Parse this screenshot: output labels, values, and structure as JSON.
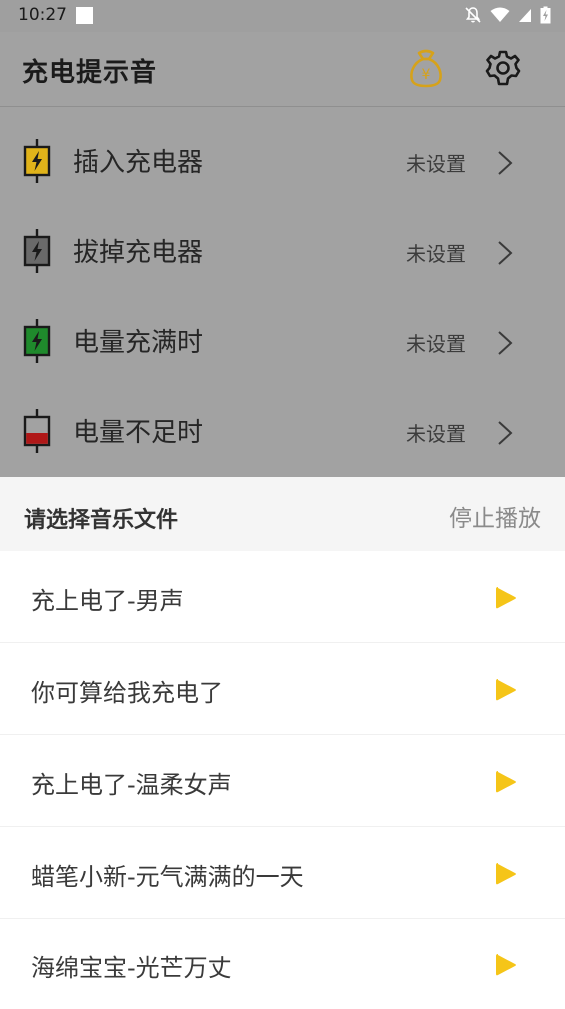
{
  "status_bar": {
    "time": "10:27"
  },
  "app_bar": {
    "title": "充电提示音"
  },
  "settings": [
    {
      "label": "插入充电器",
      "value": "未设置",
      "icon": "battery-plug-in-icon",
      "color": "#e0b31a"
    },
    {
      "label": "拔掉充电器",
      "value": "未设置",
      "icon": "battery-unplug-icon",
      "color": "#6a6a6a"
    },
    {
      "label": "电量充满时",
      "value": "未设置",
      "icon": "battery-full-icon",
      "color": "#1f8a2c"
    },
    {
      "label": "电量不足时",
      "value": "未设置",
      "icon": "battery-low-icon",
      "color": "#b01818"
    }
  ],
  "sheet": {
    "title": "请选择音乐文件",
    "stop_label": "停止播放",
    "tracks": [
      {
        "name": "充上电了-男声"
      },
      {
        "name": "你可算给我充电了"
      },
      {
        "name": "充上电了-温柔女声"
      },
      {
        "name": "蜡笔小新-元气满满的一天"
      },
      {
        "name": "海绵宝宝-光芒万丈"
      }
    ]
  },
  "colors": {
    "accent": "#f5c518",
    "dim_overlay": "#a2a2a2"
  }
}
